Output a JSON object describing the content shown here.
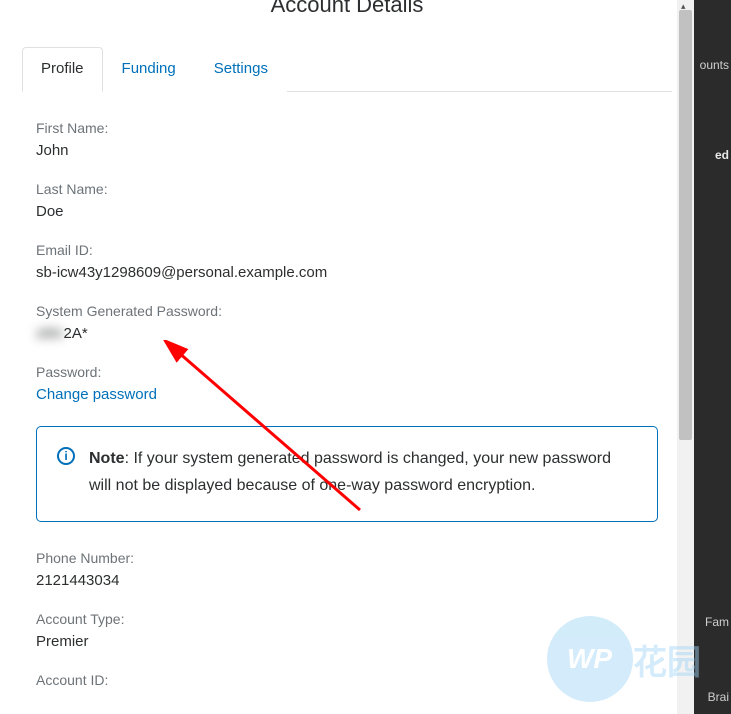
{
  "title": "Account Details",
  "tabs": [
    {
      "label": "Profile",
      "active": true
    },
    {
      "label": "Funding",
      "active": false
    },
    {
      "label": "Settings",
      "active": false
    }
  ],
  "fields": {
    "first_name": {
      "label": "First Name:",
      "value": "John"
    },
    "last_name": {
      "label": "Last Name:",
      "value": "Doe"
    },
    "email_id": {
      "label": "Email ID:",
      "value": "sb-icw43y1298609@personal.example.com"
    },
    "sys_password": {
      "label": "System Generated Password:",
      "masked_prefix": "xMv",
      "visible_suffix": "2A*"
    },
    "password": {
      "label": "Password:",
      "link_label": "Change password"
    },
    "phone": {
      "label": "Phone Number:",
      "value": "2121443034"
    },
    "account_type": {
      "label": "Account Type:",
      "value": "Premier"
    },
    "account_id": {
      "label": "Account ID:",
      "value": ""
    }
  },
  "note": {
    "bold": "Note",
    "text": ": If your system generated password is changed, your new password will not be displayed because of one-way password encryption."
  },
  "background_snips": {
    "a": "ounts",
    "b": "ed",
    "c": "Fam",
    "d": "Brai"
  },
  "watermark": {
    "badge": "WP",
    "text": "花园"
  }
}
